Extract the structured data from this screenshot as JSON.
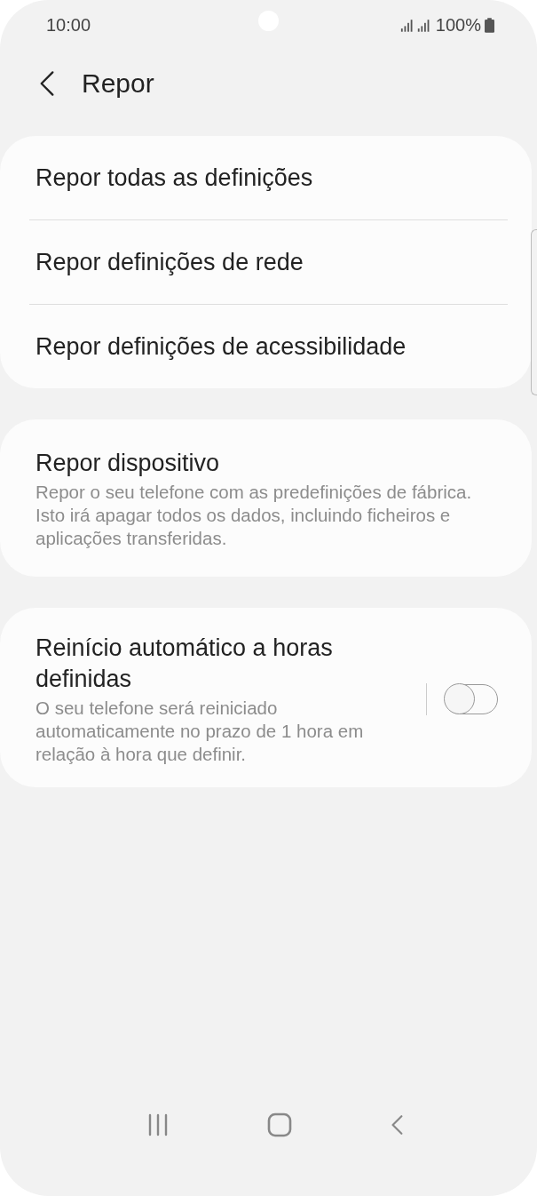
{
  "status_bar": {
    "time": "10:00",
    "battery": "100%"
  },
  "header": {
    "title": "Repor"
  },
  "groups": [
    {
      "items": [
        {
          "kind": "plain",
          "title": "Repor todas as definições"
        },
        {
          "kind": "plain",
          "title": "Repor definições de rede"
        },
        {
          "kind": "plain",
          "title": "Repor definições de acessibilidade"
        }
      ]
    },
    {
      "items": [
        {
          "kind": "described",
          "title": "Repor dispositivo",
          "description": "Repor o seu telefone com as predefinições de fábrica. Isto irá apagar todos os dados, incluindo ficheiros e aplicações transferidas."
        }
      ]
    },
    {
      "items": [
        {
          "kind": "switch",
          "title": "Reinício automático a horas definidas",
          "description": "O seu telefone será reiniciado automaticamente no prazo de 1 hora em relação à hora que definir.",
          "on": false
        }
      ]
    }
  ]
}
